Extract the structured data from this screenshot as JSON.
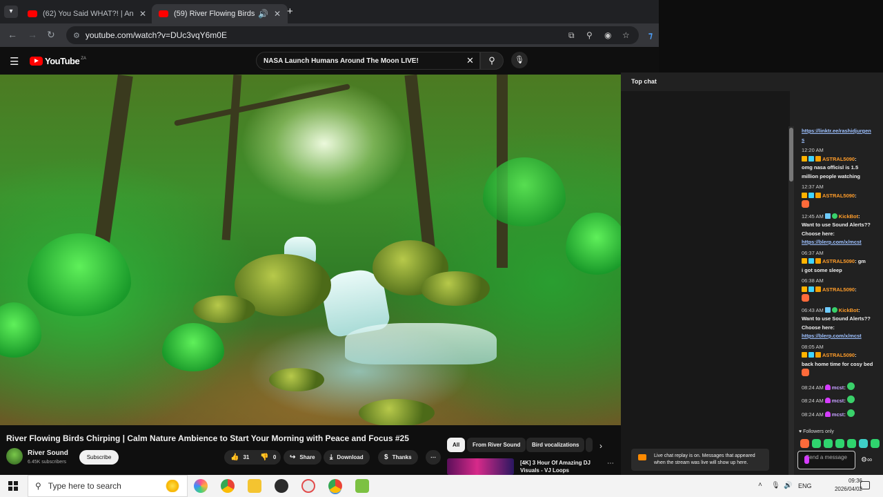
{
  "browser": {
    "tabs": [
      {
        "title": "(62) You Said WHAT?! | Anderson",
        "active": false
      },
      {
        "title": "(59) River Flowing Birds Chirping",
        "active": true
      }
    ],
    "url": "youtube.com/watch?v=DUc3vqY6m0E"
  },
  "youtube": {
    "logo_text": "YouTube",
    "country_code": "ZA",
    "search_value": "NASA Launch Humans Around The Moon LIVE!"
  },
  "video": {
    "title": "River Flowing Birds Chirping | Calm Nature Ambience to Start Your Morning with Peace and Focus #25",
    "channel": "River Sound",
    "subscribers": "6.45K subscribers",
    "subscribe_label": "Subscribe",
    "likes": "31",
    "dislikes": "0",
    "share_label": "Share",
    "download_label": "Download",
    "thanks_label": "Thanks"
  },
  "chips": [
    "All",
    "From River Sound",
    "Bird vocalizations"
  ],
  "recommendation": {
    "title": "[4K] 3 Hour Of Amazing DJ Visuals - VJ Loops"
  },
  "chat": {
    "header": "Top chat",
    "lines": [
      {
        "type": "link",
        "text": "https://linktr.ee/rashidjurgen"
      },
      {
        "type": "link",
        "text": "s"
      },
      {
        "type": "time",
        "text": "12:20 AM"
      },
      {
        "type": "user",
        "user": "ASTRAL5090",
        "text": ":"
      },
      {
        "type": "text",
        "text": "omg nasa officisl is 1.5"
      },
      {
        "type": "text",
        "text": "million people watching"
      },
      {
        "type": "time",
        "text": "12:37 AM"
      },
      {
        "type": "user",
        "user": "ASTRAL5090",
        "text": ":"
      },
      {
        "type": "emote",
        "text": ""
      },
      {
        "type": "bot",
        "time": "12:45 AM",
        "user": "KickBot",
        "text": ":"
      },
      {
        "type": "text",
        "text": "Want to use Sound Alerts??"
      },
      {
        "type": "text",
        "text": "Choose here:"
      },
      {
        "type": "link",
        "text": "https://blerp.com/x/mcst"
      },
      {
        "type": "time",
        "text": "06:37 AM"
      },
      {
        "type": "user",
        "user": "ASTRAL5090",
        "text": ": gm"
      },
      {
        "type": "text",
        "text": "i got some sleep"
      },
      {
        "type": "time",
        "text": "06:38 AM"
      },
      {
        "type": "user",
        "user": "ASTRAL5090",
        "text": ":"
      },
      {
        "type": "emote",
        "text": ""
      },
      {
        "type": "bot",
        "time": "06:43 AM",
        "user": "KickBot",
        "text": ":"
      },
      {
        "type": "text",
        "text": "Want to use Sound Alerts??"
      },
      {
        "type": "text",
        "text": "Choose here:"
      },
      {
        "type": "link",
        "text": "https://blerp.com/x/mcst"
      },
      {
        "type": "time",
        "text": "08:05 AM"
      },
      {
        "type": "user",
        "user": "ASTRAL5090",
        "text": ":"
      },
      {
        "type": "text",
        "text": "back home time for cosy bed"
      },
      {
        "type": "emote",
        "text": ""
      },
      {
        "type": "mcst",
        "time": "08:24 AM",
        "user": "mcst",
        "text": ":"
      },
      {
        "type": "mcst",
        "time": "08:24 AM",
        "user": "mcst",
        "text": ":"
      },
      {
        "type": "mcst",
        "time": "08:24 AM",
        "user": "mcst",
        "text": ":"
      }
    ],
    "followers_only": "Followers only",
    "send_placeholder": "Send a message",
    "replay_notice": "Live chat replay is on. Messages that appeared when the stream was live will show up here."
  },
  "taskbar": {
    "search_placeholder": "Type here to search",
    "language": "ENG",
    "time": "09:36",
    "date": "2026/04/02"
  }
}
